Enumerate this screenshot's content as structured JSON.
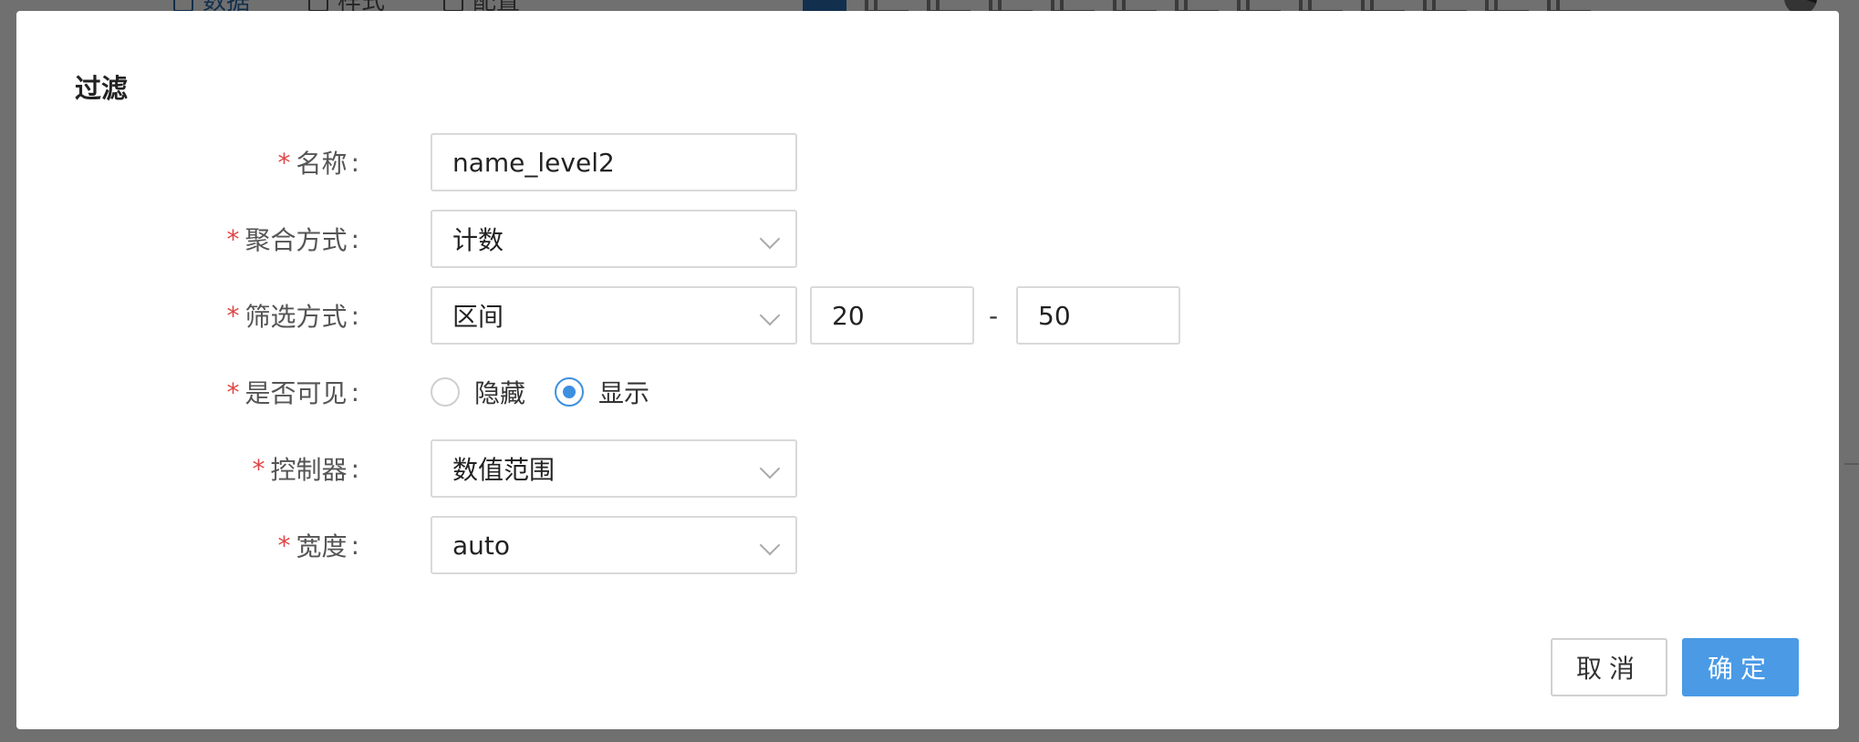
{
  "background": {
    "tabs": [
      {
        "label": "数据"
      },
      {
        "label": "样式"
      },
      {
        "label": "配置"
      }
    ]
  },
  "dialog": {
    "title": "过滤",
    "required_mark": "*",
    "fields": {
      "name": {
        "label": "名称",
        "value": "name_level2"
      },
      "aggregation": {
        "label": "聚合方式",
        "value": "计数"
      },
      "filter_method": {
        "label": "筛选方式",
        "value": "区间",
        "range_min": "20",
        "range_sep": "-",
        "range_max": "50"
      },
      "visibility": {
        "label": "是否可见",
        "options": [
          {
            "label": "隐藏",
            "checked": false
          },
          {
            "label": "显示",
            "checked": true
          }
        ]
      },
      "controller": {
        "label": "控制器",
        "value": "数值范围"
      },
      "width": {
        "label": "宽度",
        "value": "auto"
      }
    },
    "buttons": {
      "cancel": "取消",
      "ok": "确定"
    }
  },
  "colors": {
    "accent": "#4a9ae6",
    "required": "#e04545"
  }
}
